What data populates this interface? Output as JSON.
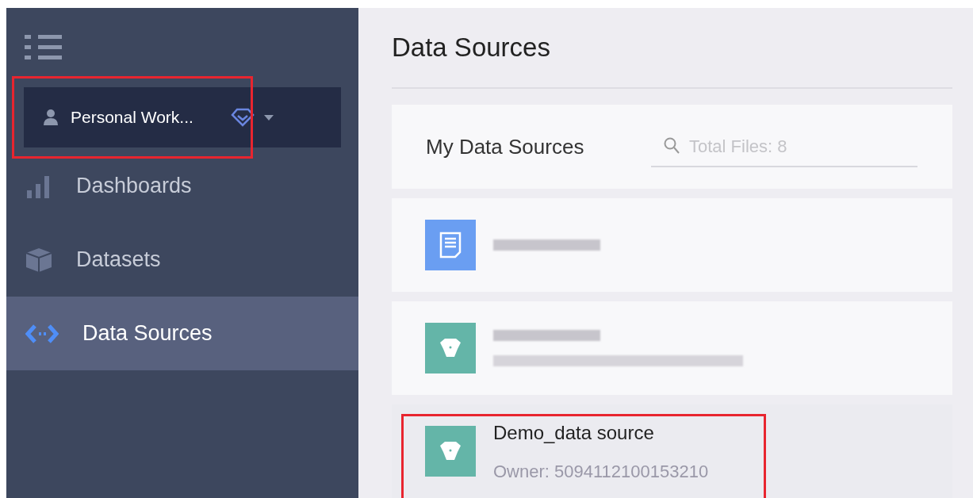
{
  "sidebar": {
    "workspace": {
      "label": "Personal Work...",
      "highlighted": true
    },
    "items": [
      {
        "label": "Dashboards",
        "kind": "bars",
        "selected": false
      },
      {
        "label": "Datasets",
        "kind": "cube",
        "selected": false
      },
      {
        "label": "Data Sources",
        "kind": "code",
        "selected": true
      }
    ]
  },
  "page": {
    "title": "Data Sources"
  },
  "list_header": {
    "title": "My Data Sources",
    "search": {
      "placeholder": "Total Files: 8"
    }
  },
  "sources": [
    {
      "kind": "document",
      "redacted": true,
      "highlighted": false
    },
    {
      "kind": "database",
      "redacted": true,
      "highlighted": false
    },
    {
      "kind": "database",
      "name": "Demo_data source",
      "owner": "Owner: 5094112100153210",
      "redacted": false,
      "highlighted": true
    }
  ]
}
